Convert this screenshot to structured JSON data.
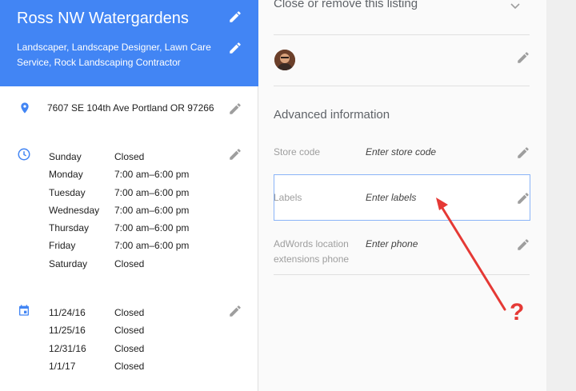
{
  "business": {
    "name": "Ross NW Watergardens",
    "categories": "Landscaper, Landscape Designer, Lawn Care Service, Rock Landscaping Contractor",
    "address": "7607 SE 104th Ave Portland OR 97266"
  },
  "hours": [
    {
      "day": "Sunday",
      "time": "Closed"
    },
    {
      "day": "Monday",
      "time": "7:00 am–6:00 pm"
    },
    {
      "day": "Tuesday",
      "time": "7:00 am–6:00 pm"
    },
    {
      "day": "Wednesday",
      "time": "7:00 am–6:00 pm"
    },
    {
      "day": "Thursday",
      "time": "7:00 am–6:00 pm"
    },
    {
      "day": "Friday",
      "time": "7:00 am–6:00 pm"
    },
    {
      "day": "Saturday",
      "time": "Closed"
    }
  ],
  "special_hours": [
    {
      "date": "11/24/16",
      "time": "Closed"
    },
    {
      "date": "11/25/16",
      "time": "Closed"
    },
    {
      "date": "12/31/16",
      "time": "Closed"
    },
    {
      "date": "1/1/17",
      "time": "Closed"
    }
  ],
  "right": {
    "close_title": "Close or remove this listing",
    "advanced_title": "Advanced information",
    "fields": [
      {
        "label": "Store code",
        "value": "Enter store code"
      },
      {
        "label": "Labels",
        "value": "Enter labels"
      },
      {
        "label": "AdWords location extensions phone",
        "value": "Enter phone"
      }
    ]
  },
  "annotation": {
    "mark": "?"
  },
  "colors": {
    "brand": "#4285f4",
    "annotation": "#e53935",
    "icon": "#4285f4"
  },
  "icons": {
    "edit": "pencil-icon",
    "address": "location-pin-icon",
    "hours": "clock-icon",
    "special": "calendar-icon",
    "collapse": "chevron-down-icon"
  }
}
